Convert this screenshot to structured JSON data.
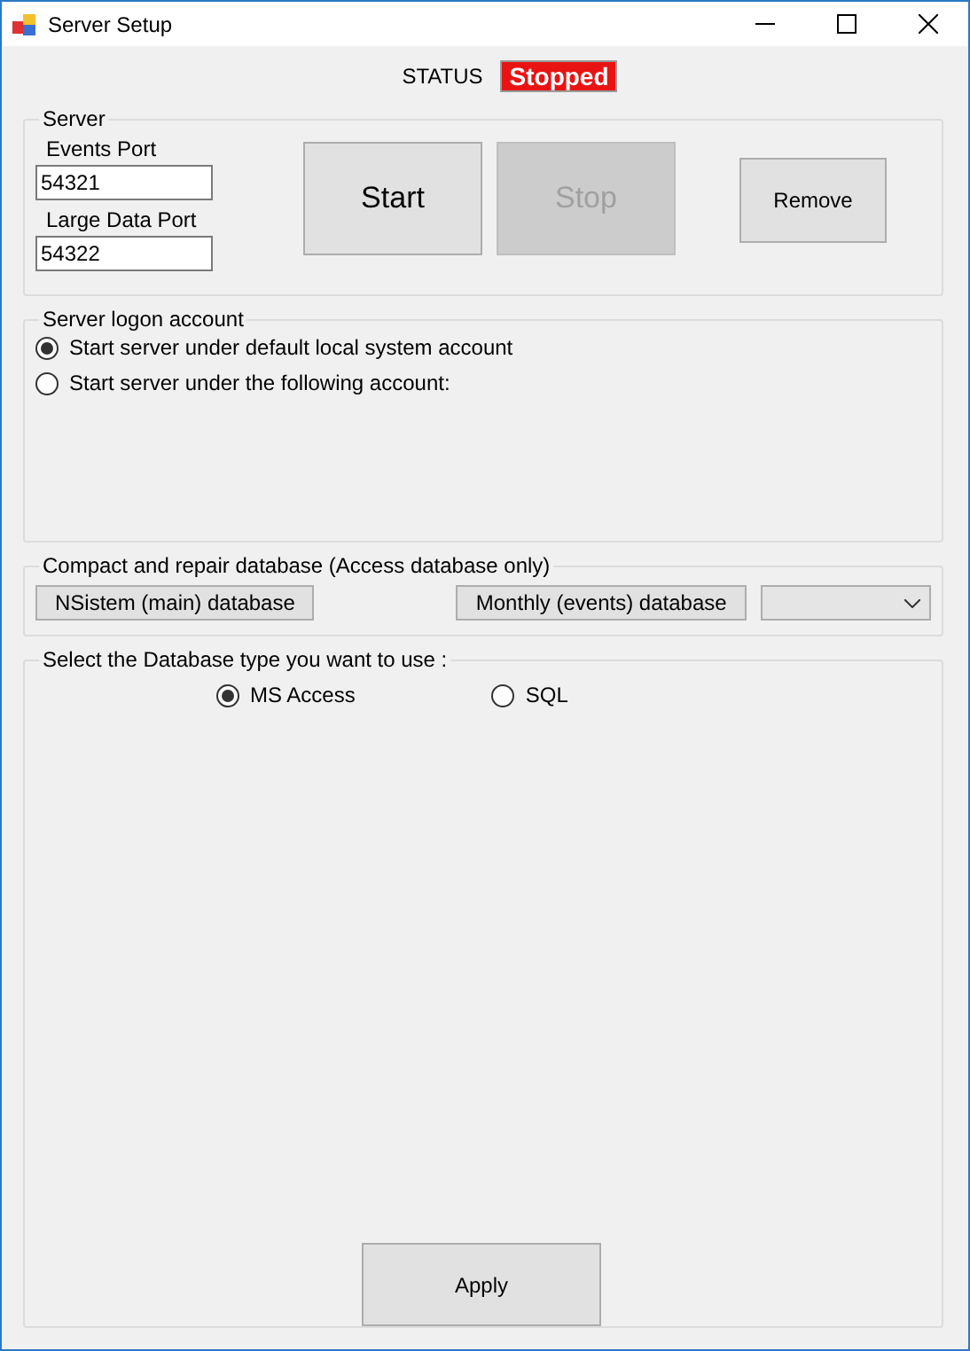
{
  "window": {
    "title": "Server Setup"
  },
  "status": {
    "label": "STATUS",
    "value": "Stopped"
  },
  "server": {
    "title": "Server",
    "fields": [
      {
        "label": "Events Port",
        "value": "54321"
      },
      {
        "label": "Large Data Port",
        "value": "54322"
      }
    ],
    "buttons": [
      {
        "label": "Start",
        "disabled": false,
        "kind": "large"
      },
      {
        "label": "Stop",
        "disabled": true,
        "kind": "large"
      },
      {
        "label": "Remove",
        "disabled": false,
        "kind": "small"
      }
    ]
  },
  "logon": {
    "title": "Server logon account",
    "options": [
      {
        "label": "Start server under default local system account",
        "selected": true
      },
      {
        "label": "Start server under the following account:",
        "selected": false
      }
    ]
  },
  "compact": {
    "title": "Compact and repair database (Access database only)",
    "buttons": [
      "NSistem (main) database",
      "Monthly (events) database"
    ]
  },
  "db_type": {
    "title": "Select the Database type you want to use :",
    "options": [
      {
        "label": "MS Access",
        "selected": true
      },
      {
        "label": "SQL",
        "selected": false
      }
    ]
  },
  "apply": "Apply"
}
